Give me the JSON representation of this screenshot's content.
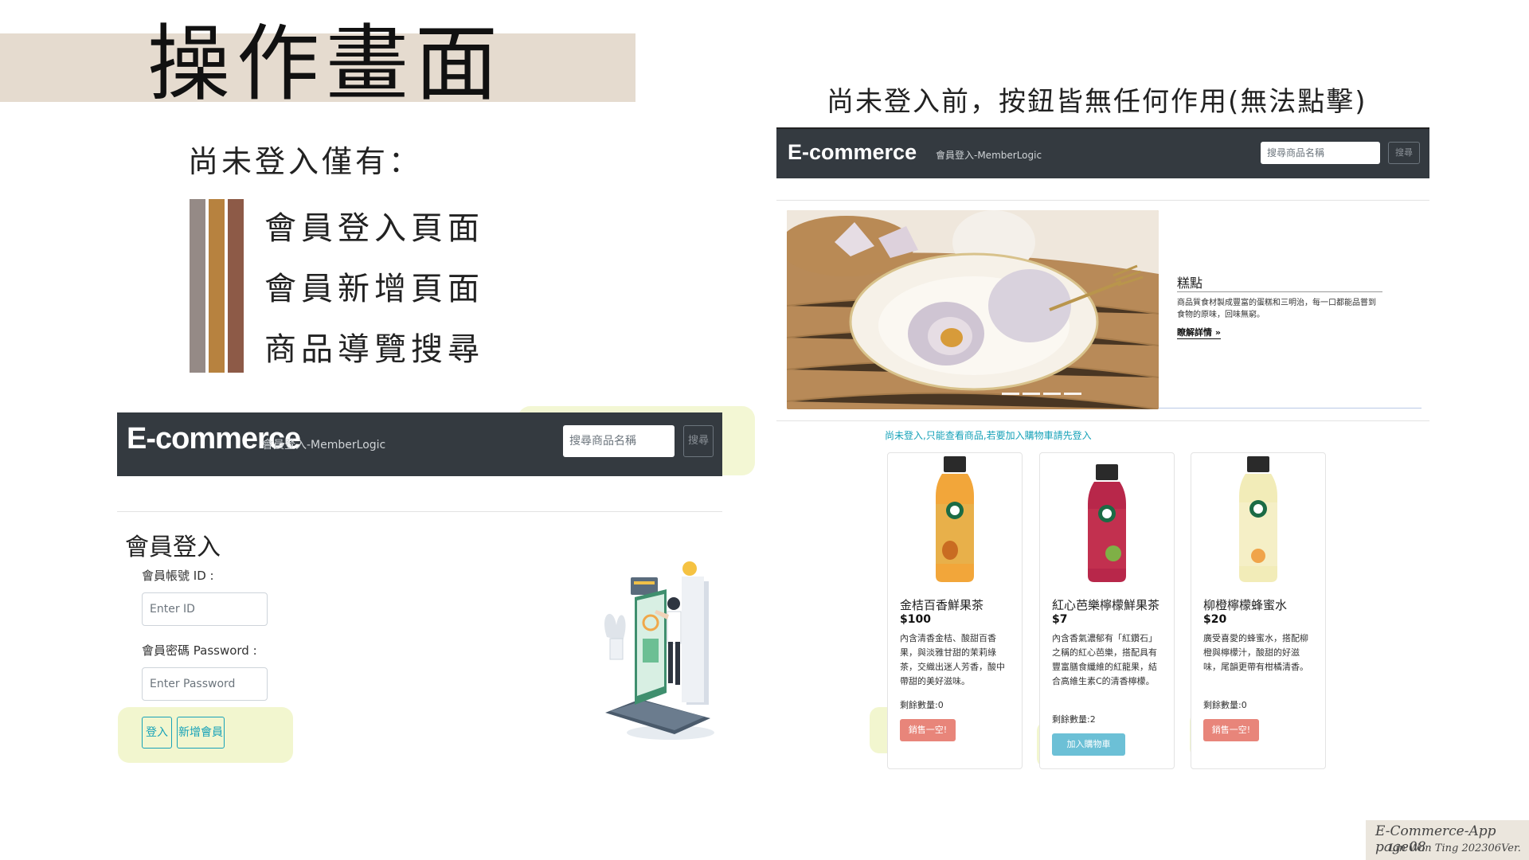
{
  "title": "操作畫面",
  "left": {
    "subtitle": "尚未登入僅有：",
    "features": [
      "會員登入頁面",
      "會員新增頁面",
      "商品導覽搜尋"
    ],
    "stripe_colors": [
      "#958a86",
      "#b7823f",
      "#8d5a47"
    ]
  },
  "navbar": {
    "brand": "E-commerce",
    "member": "會員登入-MemberLogic",
    "search_placeholder": "搜尋商品名稱",
    "search_button": "搜尋"
  },
  "login": {
    "title": "會員登入",
    "id_label": "會員帳號 ID :",
    "id_placeholder": "Enter ID",
    "password_label": "會員密碼 Password :",
    "password_placeholder": "Enter Password",
    "login_button": "登入",
    "register_button": "新增會員"
  },
  "right": {
    "subtitle": "尚未登入前，按鈕皆無任何作用(無法點擊)",
    "carousel": {
      "caption_title": "糕點",
      "caption_text": "商品質食材製成豐富的蛋糕和三明治，每一口都能品嘗到食物的原味，回味無窮。",
      "caption_link": "瞭解詳情 »"
    },
    "notice": "尚未登入,只能查看商品,若要加入購物車請先登入",
    "products": [
      {
        "name": "金桔百香鮮果茶",
        "price": "$100",
        "desc": "內含清香金桔、酸甜百香果，與淡雅甘甜的茉莉綠茶，交織出迷人芳香，酸中帶甜的美好滋味。",
        "stock": "剩餘數量:0",
        "button": "銷售一空!",
        "button_color": "#e8857a"
      },
      {
        "name": "紅心芭樂檸檬鮮果茶",
        "price": "$7",
        "desc": "內含香氣濃郁有「紅鑽石」之稱的紅心芭樂，搭配具有豐富膳食纖維的紅龍果，結合高維生素C的清香檸檬。",
        "stock": "剩餘數量:2",
        "button": "加入購物車",
        "button_color": "#6cc0d6"
      },
      {
        "name": "柳橙檸檬蜂蜜水",
        "price": "$20",
        "desc": "廣受喜愛的蜂蜜水，搭配柳橙與檸檬汁，酸甜的好滋味，尾韻更帶有柑橘清香。",
        "stock": "剩餘數量:0",
        "button": "銷售一空!",
        "button_color": "#e8857a"
      }
    ]
  },
  "footer": {
    "line1": "E-Commerce-App page08",
    "line2": "Lin Wan Ting 202306Ver."
  }
}
